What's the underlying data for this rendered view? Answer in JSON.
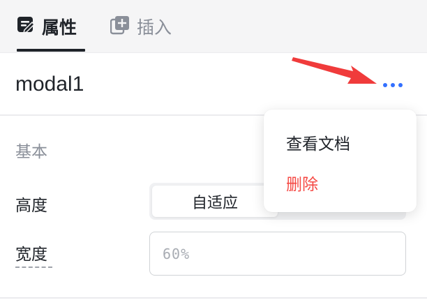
{
  "tabs": [
    {
      "label": "属性",
      "icon": "edit-doc-icon",
      "active": true
    },
    {
      "label": "插入",
      "icon": "add-copy-icon",
      "active": false
    }
  ],
  "component": {
    "name": "modal1",
    "more_icon": "more-horizontal-icon"
  },
  "section": {
    "title": "基本"
  },
  "fields": {
    "height": {
      "label": "高度",
      "options": [
        "自适应"
      ],
      "selected": "自适应"
    },
    "width": {
      "label": "宽度",
      "placeholder": "60%",
      "value": ""
    }
  },
  "menu": {
    "items": [
      "查看文档",
      "删除"
    ]
  },
  "colors": {
    "accent": "#3370ff",
    "danger": "#f54a45",
    "annotation": "#f03b3b",
    "muted": "#8a8f99",
    "text": "#1f2329"
  }
}
